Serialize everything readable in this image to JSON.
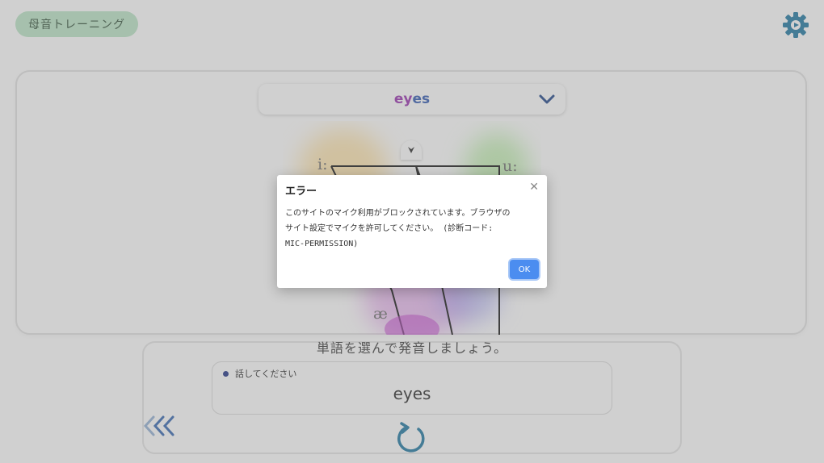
{
  "header": {
    "app_title": "母音トレーニング",
    "settings_icon": "gear-icon"
  },
  "word_selector": {
    "word_part1": "ey",
    "word_part2": "es",
    "icon": "chevron-down-icon"
  },
  "vowel_chart": {
    "labels": [
      "i:",
      "u:",
      "æ"
    ]
  },
  "practice": {
    "instruction": "単語を選んで発音しましょう。",
    "status": "話してください",
    "spoken_word": "eyes",
    "back_icon": "double-chevron-left-icon",
    "retry_icon": "refresh-icon"
  },
  "dialog": {
    "title": "エラー",
    "message_line1": "このサイトのマイク利用がブロックされています。ブラウザの",
    "message_line2": "サイト設定でマイクを許可してください。 (診断コード:",
    "message_line3": "MIC-PERMISSION)",
    "ok_label": "OK",
    "close_icon": "close-icon"
  },
  "colors": {
    "accent": "#2a7fa6",
    "badge_bg": "#bfe6c9",
    "ok_button": "#4b8df0"
  }
}
